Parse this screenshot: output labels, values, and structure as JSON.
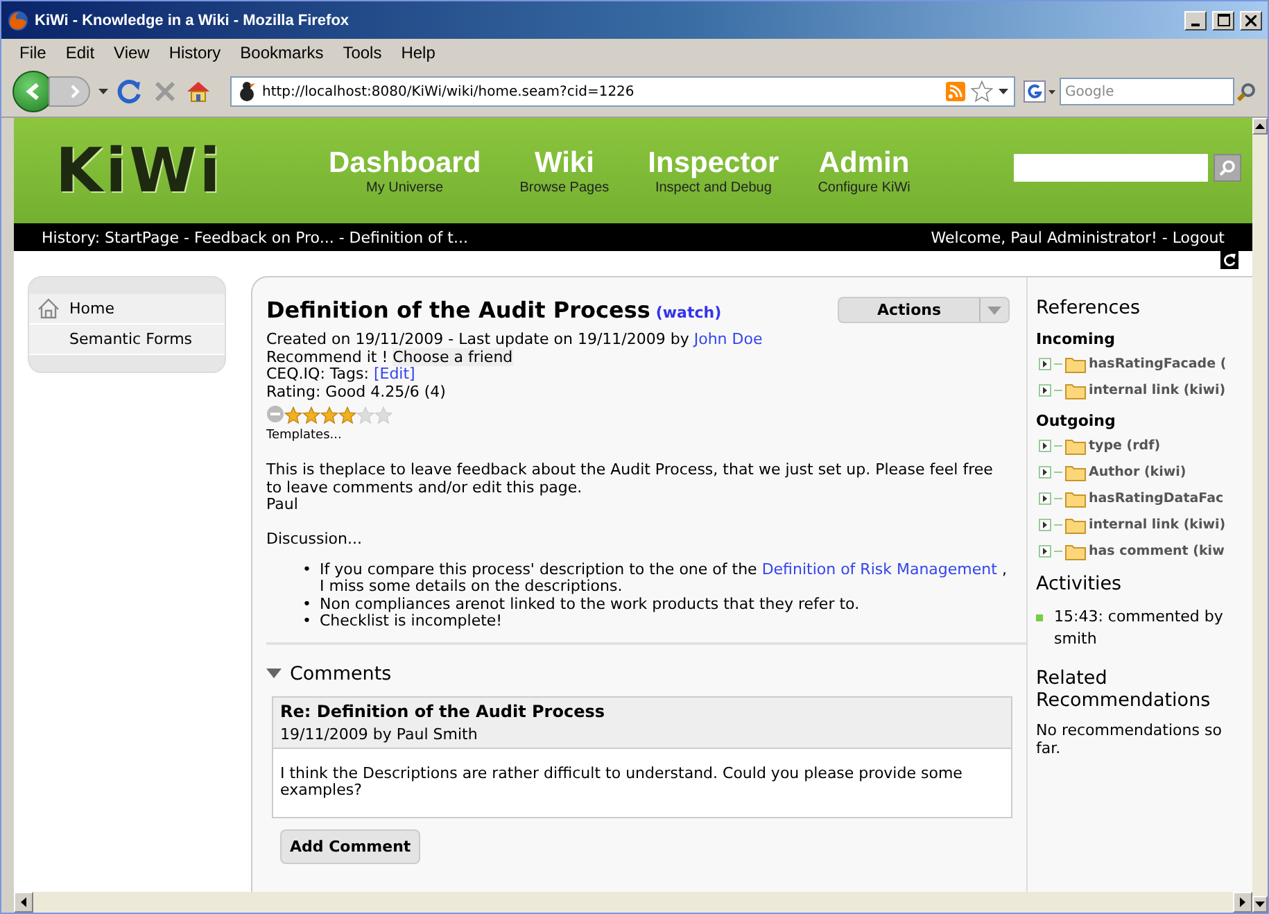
{
  "browser": {
    "title": "KiWi - Knowledge in a Wiki - Mozilla Firefox",
    "menu": [
      "File",
      "Edit",
      "View",
      "History",
      "Bookmarks",
      "Tools",
      "Help"
    ],
    "url": "http://localhost:8080/KiWi/wiki/home.seam?cid=1226",
    "search_placeholder": "Google"
  },
  "header": {
    "logo": "KiWi",
    "nav": [
      {
        "label": "Dashboard",
        "sub": "My Universe"
      },
      {
        "label": "Wiki",
        "sub": "Browse Pages"
      },
      {
        "label": "Inspector",
        "sub": "Inspect and Debug"
      },
      {
        "label": "Admin",
        "sub": "Configure KiWi"
      }
    ]
  },
  "history_bar": {
    "history": "History: StartPage - Feedback on Pro... - Definition of t...",
    "user": "Welcome, Paul Administrator! - Logout"
  },
  "left_menu": [
    {
      "label": "Home"
    },
    {
      "label": "Semantic Forms"
    }
  ],
  "page": {
    "title": "Definition of the Audit Process",
    "watch": "(watch)",
    "actions": "Actions",
    "created": "Created on 19/11/2009 - Last update on 19/11/2009 by",
    "author": "John Doe",
    "recommend": "Recommend it !",
    "choose_friend": "Choose a friend",
    "tags": "CEQ.IQ: Tags:",
    "tags_edit": "[Edit]",
    "rating": "Rating: Good 4.25/6 (4)",
    "stars": 4,
    "templates": "Templates...",
    "body": [
      "This is theplace to leave feedback about the Audit Process, that we just set up. Please feel free to leave comments and/or edit this page.",
      "Paul"
    ],
    "discussion": "Discussion...",
    "bullets": [
      {
        "marker": "•",
        "text": "If you compare this process' description to the one of the",
        "link": "Definition of Risk Management",
        "after": ", I miss some details on the descriptions."
      },
      {
        "marker": "•",
        "text": "Non compliances arenot linked to the work products that they refer to."
      },
      {
        "marker": "•",
        "text": "Checklist is incomplete!"
      }
    ]
  },
  "comments": {
    "heading": "Comments",
    "expanded": true,
    "items": [
      {
        "title": "Re: Definition of the Audit Process",
        "meta": "19/11/2009 by Paul Smith",
        "body": "I think the Descriptions are rather difficult to understand. Could you please provide some examples?"
      }
    ],
    "add_button": "Add Comment"
  },
  "references": {
    "heading": "References",
    "groups": [
      {
        "label": "Incoming",
        "items": [
          {
            "label": "hasRatingFacade (",
            "expanded": false
          },
          {
            "label": "internal link (kiwi)",
            "expanded": false
          }
        ]
      },
      {
        "label": "Outgoing",
        "items": [
          {
            "label": "type (rdf)",
            "expanded": false
          },
          {
            "label": "Author (kiwi)",
            "expanded": false
          },
          {
            "label": "hasRatingDataFac",
            "expanded": false
          },
          {
            "label": "internal link (kiwi)",
            "expanded": false
          },
          {
            "label": "has comment (kiw",
            "expanded": false
          }
        ]
      }
    ]
  },
  "activities": {
    "heading": "Activities",
    "items": [
      "15:43: commented by smith"
    ]
  },
  "recommendations": {
    "heading": "Related Recommendations",
    "text": "No recommendations so far."
  }
}
